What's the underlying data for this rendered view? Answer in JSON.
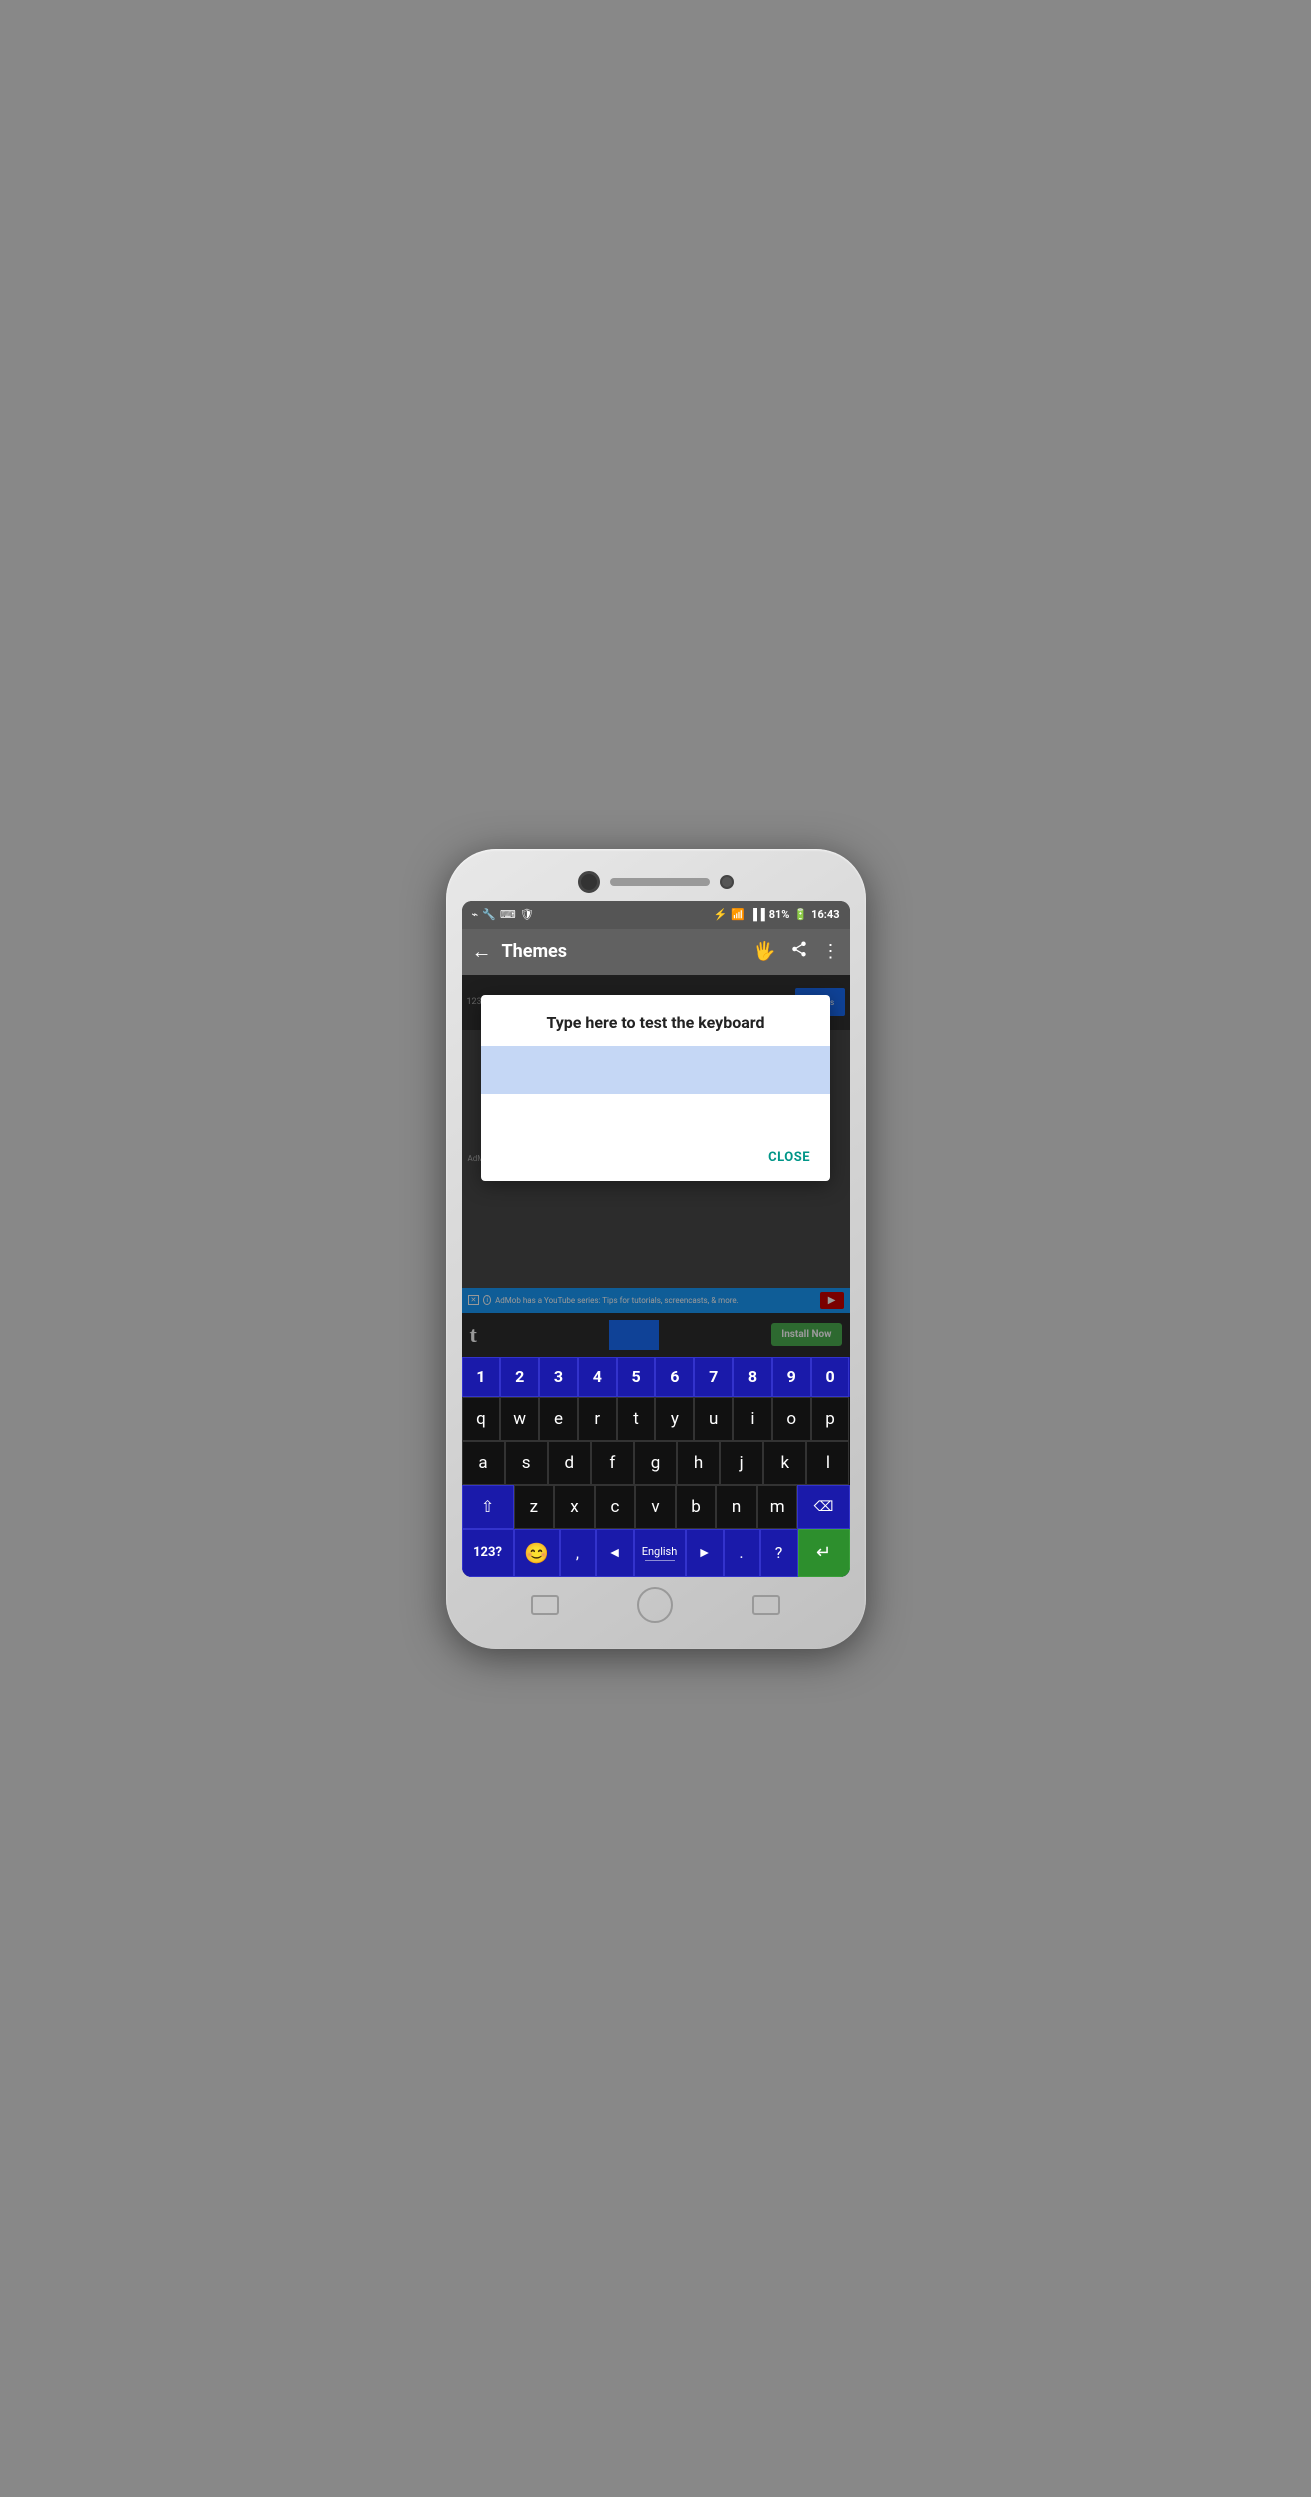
{
  "statusBar": {
    "leftIcons": [
      "usb-icon",
      "wrench-icon",
      "keyboard-icon",
      "shield-icon"
    ],
    "rightIcons": [
      "bluetooth-icon",
      "wifi-icon",
      "signal-icon"
    ],
    "battery": "81%",
    "time": "16:43"
  },
  "appBar": {
    "backLabel": "←",
    "title": "Themes",
    "handIcon": "🖐",
    "shareIcon": "share",
    "moreIcon": "⋮"
  },
  "dialog": {
    "title": "Type here to test the keyboard",
    "closeLabel": "CLOSE"
  },
  "ad": {
    "text": "AdMob has a YouTube series: Tips for tutorials, screencasts, & more.",
    "youtubeLabel": "▶",
    "installLabel": "Install Now"
  },
  "keyboard": {
    "numRow": [
      "1",
      "2",
      "3",
      "4",
      "5",
      "6",
      "7",
      "8",
      "9",
      "0"
    ],
    "row1": [
      "q",
      "w",
      "e",
      "r",
      "t",
      "y",
      "u",
      "i",
      "o",
      "p"
    ],
    "row2": [
      "a",
      "s",
      "d",
      "f",
      "g",
      "h",
      "j",
      "k",
      "l"
    ],
    "row3": [
      "z",
      "x",
      "c",
      "v",
      "b",
      "n",
      "m"
    ],
    "symbolsKey": "123?",
    "emojiKey": "😊",
    "commaKey": ",",
    "arrowLeft": "◄",
    "spaceLang": "English",
    "arrowRight": "►",
    "periodKey": ".",
    "questionKey": "?",
    "enterKey": "↵",
    "deleteKey": "⌫",
    "shiftKey": "⇧"
  }
}
